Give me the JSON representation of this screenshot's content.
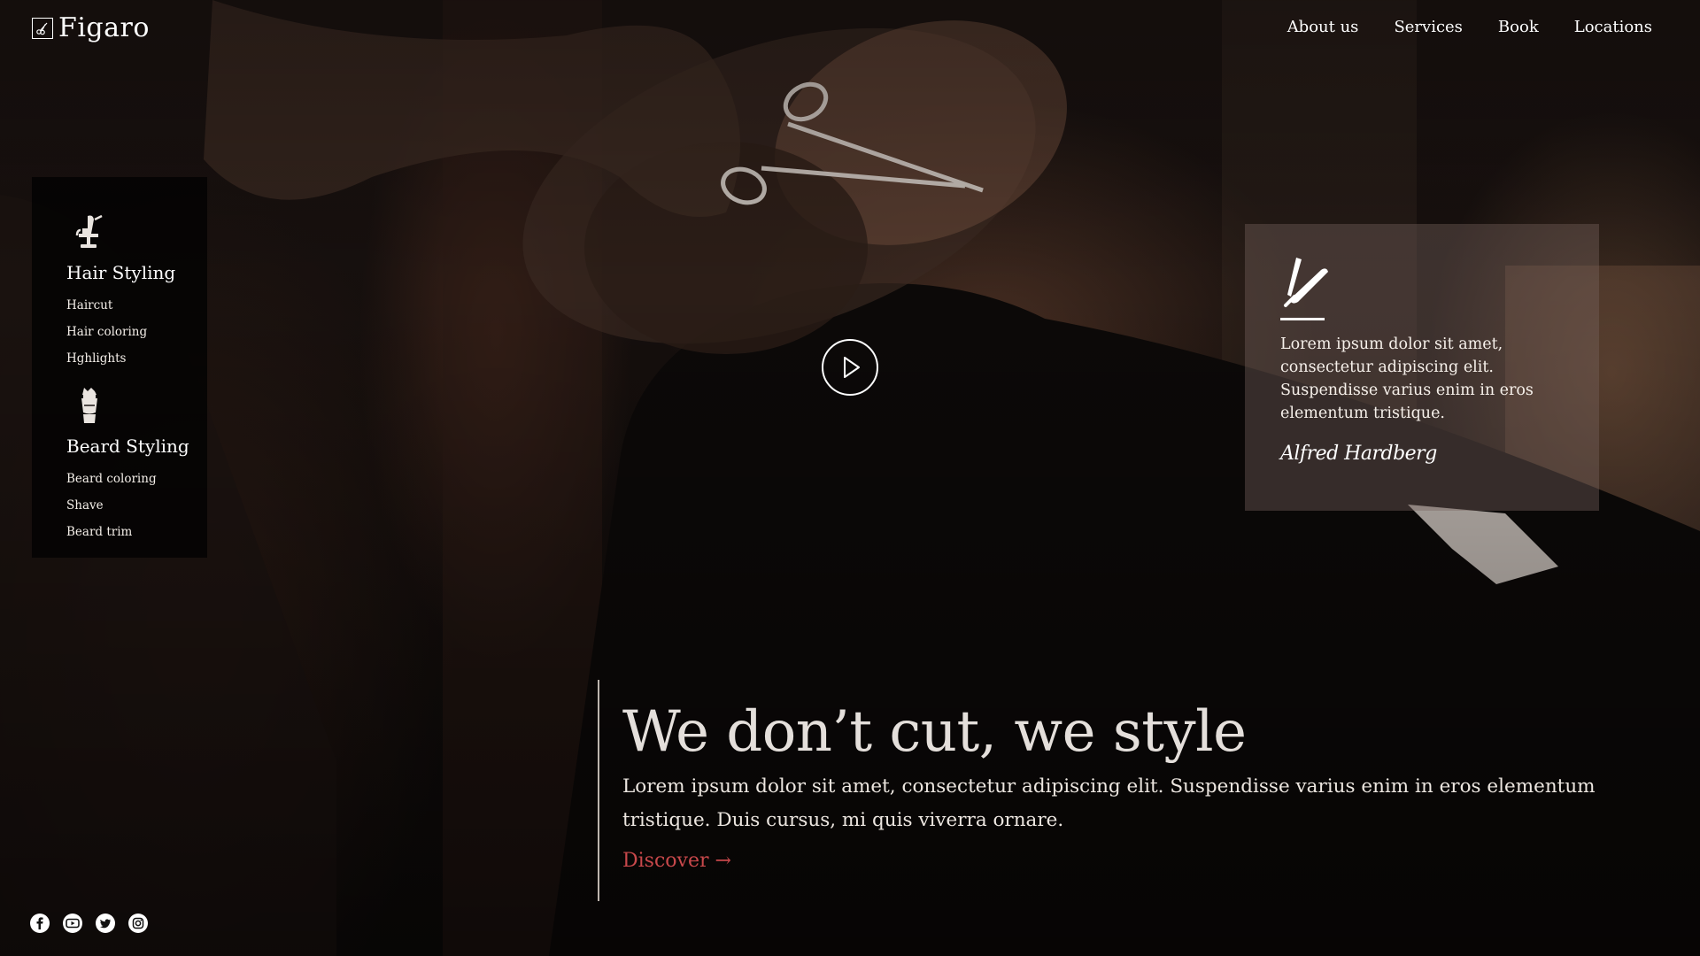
{
  "brand": {
    "name": "Figaro"
  },
  "nav": {
    "items": [
      {
        "label": "About us"
      },
      {
        "label": "Services"
      },
      {
        "label": "Book"
      },
      {
        "label": "Locations"
      }
    ]
  },
  "services": {
    "groups": [
      {
        "title": "Hair Styling",
        "icon": "barber-chair-icon",
        "items": [
          "Haircut",
          "Hair coloring",
          "Hghlights"
        ]
      },
      {
        "title": "Beard Styling",
        "icon": "shaving-brush-icon",
        "items": [
          "Beard coloring",
          "Shave",
          "Beard trim"
        ]
      }
    ]
  },
  "video": {
    "icon": "play-icon"
  },
  "testimonial": {
    "icon": "straight-razor-icon",
    "text": "Lorem ipsum dolor sit amet, consectetur adipiscing elit. Suspendisse varius enim in eros elementum tristique.",
    "author": "Alfred Hardberg"
  },
  "hero": {
    "headline": "We don’t cut, we style",
    "lead": "Lorem ipsum dolor sit amet, consectetur adipiscing elit. Suspendisse varius enim in eros elementum tristique. Duis cursus, mi quis viverra ornare.",
    "cta": "Discover →"
  },
  "social": {
    "items": [
      {
        "icon": "facebook-icon"
      },
      {
        "icon": "youtube-icon"
      },
      {
        "icon": "twitter-icon"
      },
      {
        "icon": "instagram-icon"
      }
    ]
  },
  "colors": {
    "accent": "#c8484b",
    "background": "#140e0c",
    "text": "#ffffff"
  }
}
